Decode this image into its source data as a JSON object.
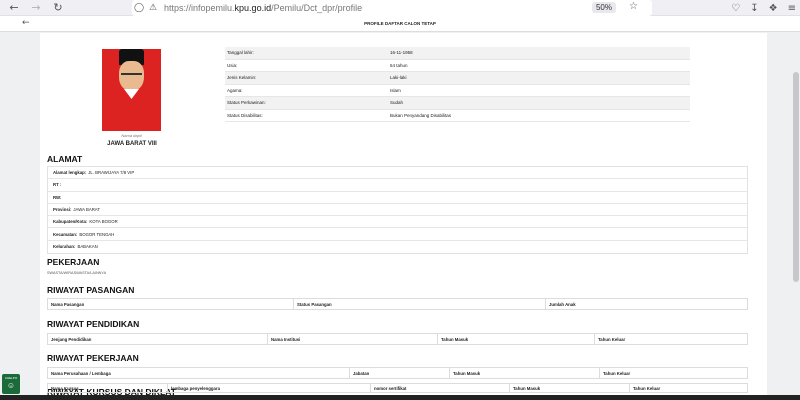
{
  "browser": {
    "url_prefix": "https://infopemilu.",
    "url_domain": "kpu.go.id",
    "url_path": "/Pemilu/Dct_dpr/profile",
    "zoom": "50%"
  },
  "page": {
    "header_title": "PROFILE DAFTAR CALON TETAP",
    "photo_caption": "Nama dapil",
    "dapil": "JAWA BARAT VIII",
    "info": [
      {
        "label": "Tanggal lahir:",
        "value": "16-11-1958"
      },
      {
        "label": "Usia:",
        "value": "64 tahun"
      },
      {
        "label": "Jenis Kelamin:",
        "value": "Laki-laki"
      },
      {
        "label": "Agama:",
        "value": "Islam"
      },
      {
        "label": "Status Perkawinan:",
        "value": "Sudah"
      },
      {
        "label": "Status Disabilitas:",
        "value": "Bukan Penyandang Disabilitas"
      }
    ],
    "alamat_title": "ALAMAT",
    "alamat": [
      {
        "label": "Alamat lengkap:",
        "value": "JL. BRAWIJAYA 7/8 VIP"
      },
      {
        "label": "RT :",
        "value": ""
      },
      {
        "label": "RW:",
        "value": ""
      },
      {
        "label": "Provinsi:",
        "value": "JAWA BARAT"
      },
      {
        "label": "Kabupaten/Kota:",
        "value": "KOTA BOGOR"
      },
      {
        "label": "Kecamatan:",
        "value": "BOGOR TENGAH"
      },
      {
        "label": "Kelurahan:",
        "value": "BABAKAN"
      }
    ],
    "pekerjaan_title": "PEKERJAAN",
    "pekerjaan_value": "SWASTA/WIRASWASTA/LAINNYA",
    "pasangan_title": "RIWAYAT PASANGAN",
    "pasangan_cols": [
      "Nama Pasangan",
      "Status Pasangan",
      "Jumlah Anak"
    ],
    "pendidikan_title": "RIWAYAT PENDIDIKAN",
    "pendidikan_cols": [
      "Jenjang Pendidikan",
      "Nama Institusi",
      "Tahun Masuk",
      "Tahun Keluar"
    ],
    "pekerjaan_riwayat_title": "RIWAYAT PEKERJAAN",
    "pekerjaan_riwayat_cols": [
      "Nama Perusahaan / Lembaga",
      "Jabatan",
      "Tahun Masuk",
      "Tahun Keluar"
    ],
    "kursus_title": "RIWAYAT KURSUS DAN DIKLAT",
    "kursus_cols": [
      "Nama Kursus",
      "lembaga penyelenggara",
      "nomor sertifikat",
      "Tahun Masuk",
      "Tahun Keluar"
    ],
    "badge_text": "CHELPO"
  }
}
